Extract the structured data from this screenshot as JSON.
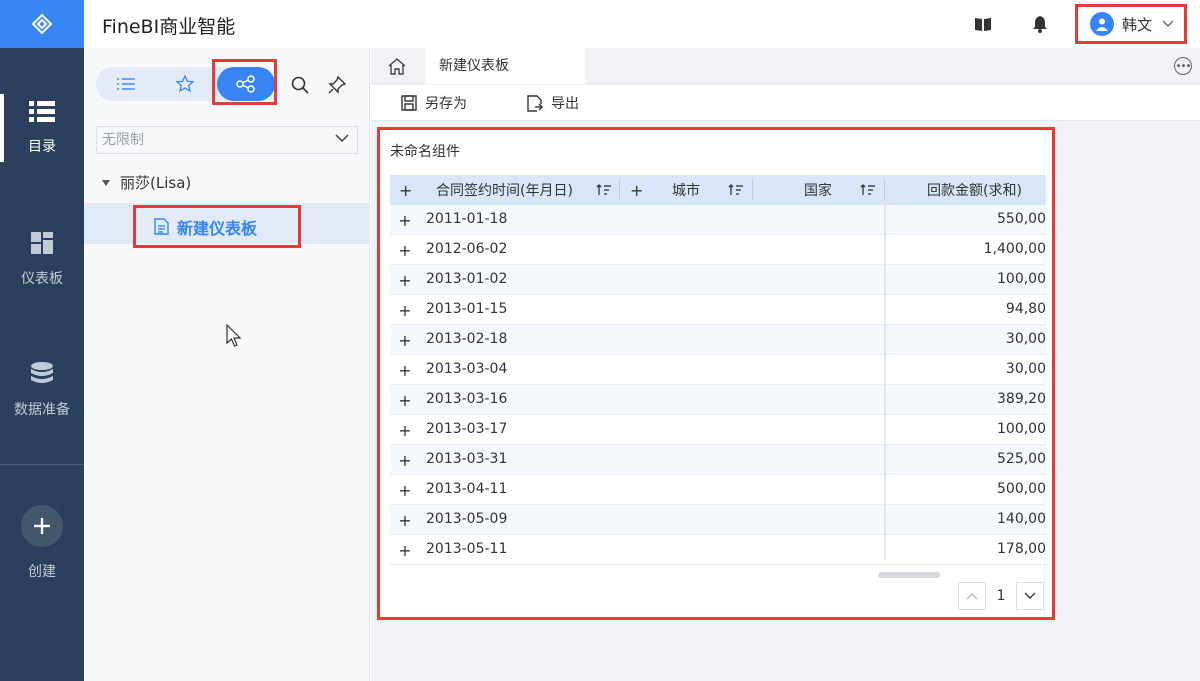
{
  "app": {
    "title": "FineBI商业智能"
  },
  "rail": {
    "items": [
      {
        "label": "目录",
        "icon": "list-icon",
        "active": true
      },
      {
        "label": "仪表板",
        "icon": "dashboard-icon",
        "active": false
      },
      {
        "label": "数据准备",
        "icon": "database-icon",
        "active": false
      }
    ],
    "create_label": "创建"
  },
  "user": {
    "name": "韩文"
  },
  "catalog": {
    "filter_value": "无限制",
    "tree": {
      "root_label": "丽莎(Lisa)",
      "item_label": "新建仪表板"
    }
  },
  "workspace": {
    "tab_label": "新建仪表板",
    "toolbar": {
      "save_as_label": "另存为",
      "export_label": "导出"
    }
  },
  "widget": {
    "title": "未命名组件",
    "columns": [
      "合同签约时间(年月日)",
      "城市",
      "国家",
      "回款金额(求和)"
    ],
    "rows": [
      {
        "date": "2011-01-18",
        "amount": "550,00"
      },
      {
        "date": "2012-06-02",
        "amount": "1,400,00"
      },
      {
        "date": "2013-01-02",
        "amount": "100,00"
      },
      {
        "date": "2013-01-15",
        "amount": "94,80"
      },
      {
        "date": "2013-02-18",
        "amount": "30,00"
      },
      {
        "date": "2013-03-04",
        "amount": "30,00"
      },
      {
        "date": "2013-03-16",
        "amount": "389,20"
      },
      {
        "date": "2013-03-17",
        "amount": "100,00"
      },
      {
        "date": "2013-03-31",
        "amount": "525,00"
      },
      {
        "date": "2013-04-11",
        "amount": "500,00"
      },
      {
        "date": "2013-05-09",
        "amount": "140,00"
      },
      {
        "date": "2013-05-11",
        "amount": "178,00"
      }
    ],
    "page": "1"
  },
  "colors": {
    "accent": "#3685f2",
    "rail_bg": "#2c3f5e",
    "highlight": "#e03c3c"
  }
}
